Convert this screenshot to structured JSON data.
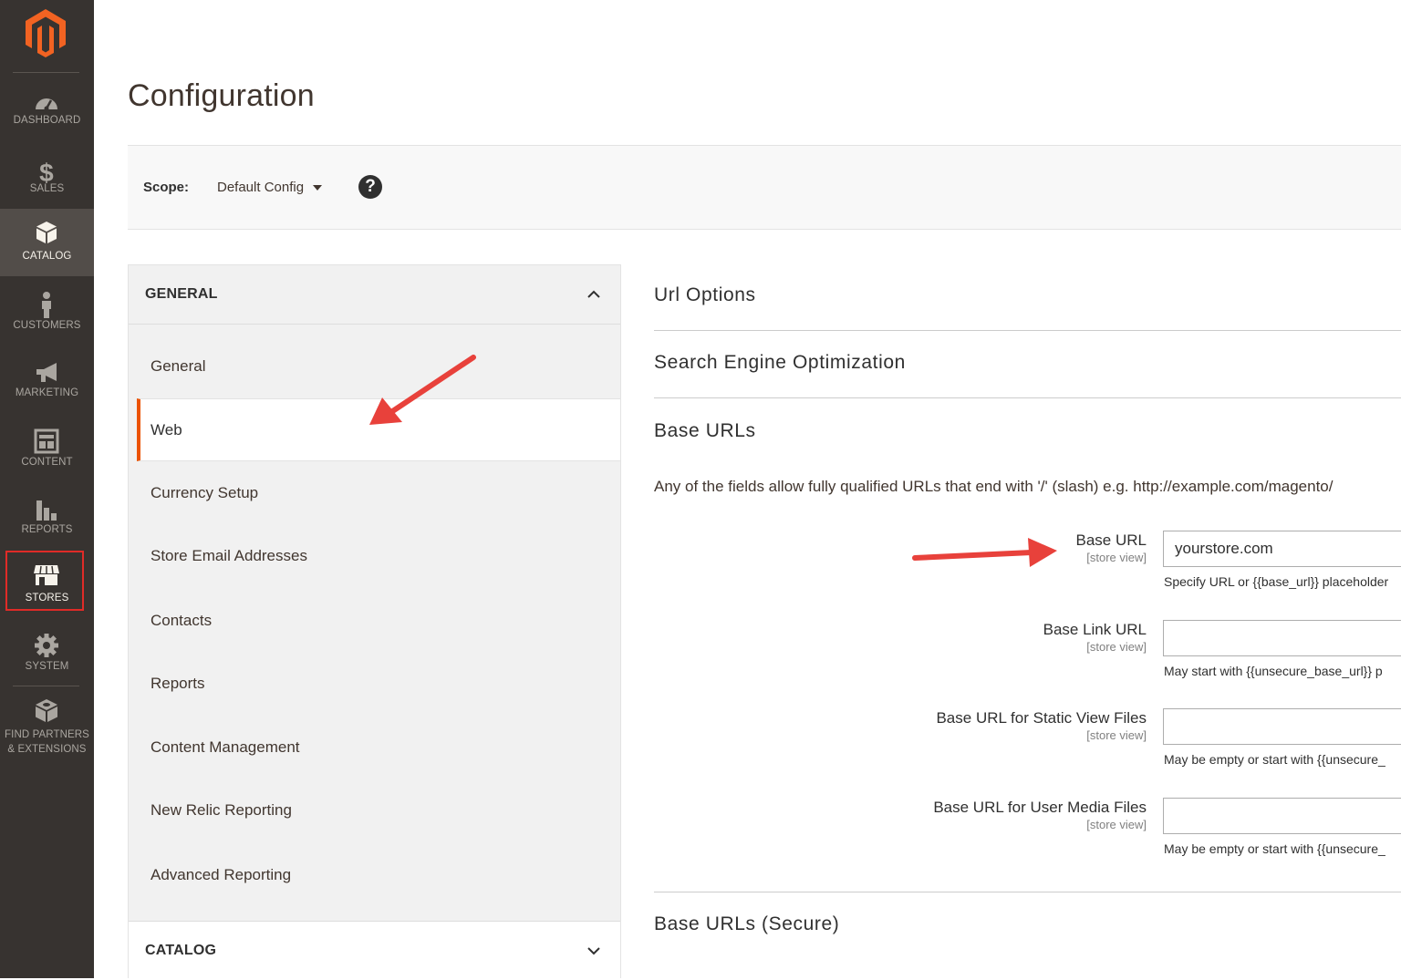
{
  "page": {
    "title": "Configuration"
  },
  "nav": {
    "items": [
      {
        "key": "dashboard",
        "label": "DASHBOARD",
        "icon": "dashboard-icon"
      },
      {
        "key": "sales",
        "label": "SALES",
        "icon": "dollar-icon"
      },
      {
        "key": "catalog",
        "label": "CATALOG",
        "icon": "box-icon"
      },
      {
        "key": "customers",
        "label": "CUSTOMERS",
        "icon": "person-icon"
      },
      {
        "key": "marketing",
        "label": "MARKETING",
        "icon": "megaphone-icon"
      },
      {
        "key": "content",
        "label": "CONTENT",
        "icon": "layout-icon"
      },
      {
        "key": "reports",
        "label": "REPORTS",
        "icon": "bar-chart-icon"
      },
      {
        "key": "stores",
        "label": "STORES",
        "icon": "storefront-icon"
      },
      {
        "key": "system",
        "label": "SYSTEM",
        "icon": "gear-icon"
      },
      {
        "key": "partners",
        "label_line1": "FIND PARTNERS",
        "label_line2": "& EXTENSIONS",
        "icon": "extensions-icon"
      }
    ]
  },
  "scope": {
    "label": "Scope:",
    "value": "Default Config"
  },
  "tabs": {
    "general": {
      "header": "GENERAL",
      "items": [
        "General",
        "Web",
        "Currency Setup",
        "Store Email Addresses",
        "Contacts",
        "Reports",
        "Content Management",
        "New Relic Reporting",
        "Advanced Reporting"
      ],
      "active_item": "Web"
    },
    "catalog": {
      "header": "CATALOG"
    }
  },
  "sections": {
    "url_options": "Url Options",
    "seo": "Search Engine Optimization",
    "base_urls": "Base URLs",
    "base_urls_secure": "Base URLs (Secure)"
  },
  "base_urls": {
    "comment": "Any of the fields allow fully qualified URLs that end with '/' (slash) e.g. http://example.com/magento/",
    "fields": [
      {
        "label": "Base URL",
        "scope": "[store view]",
        "value": "yourstore.com",
        "note": "Specify URL or {{base_url}} placeholder"
      },
      {
        "label": "Base Link URL",
        "scope": "[store view]",
        "value": "",
        "note": "May start with {{unsecure_base_url}} p"
      },
      {
        "label": "Base URL for Static View Files",
        "scope": "[store view]",
        "value": "",
        "note": "May be empty or start with {{unsecure_"
      },
      {
        "label": "Base URL for User Media Files",
        "scope": "[store view]",
        "value": "",
        "note": "May be empty or start with {{unsecure_"
      }
    ]
  },
  "colors": {
    "nav_bg": "#373330",
    "nav_active": "#524d49",
    "brand_orange": "#eb5202",
    "annotation_red": "#e02b27"
  }
}
